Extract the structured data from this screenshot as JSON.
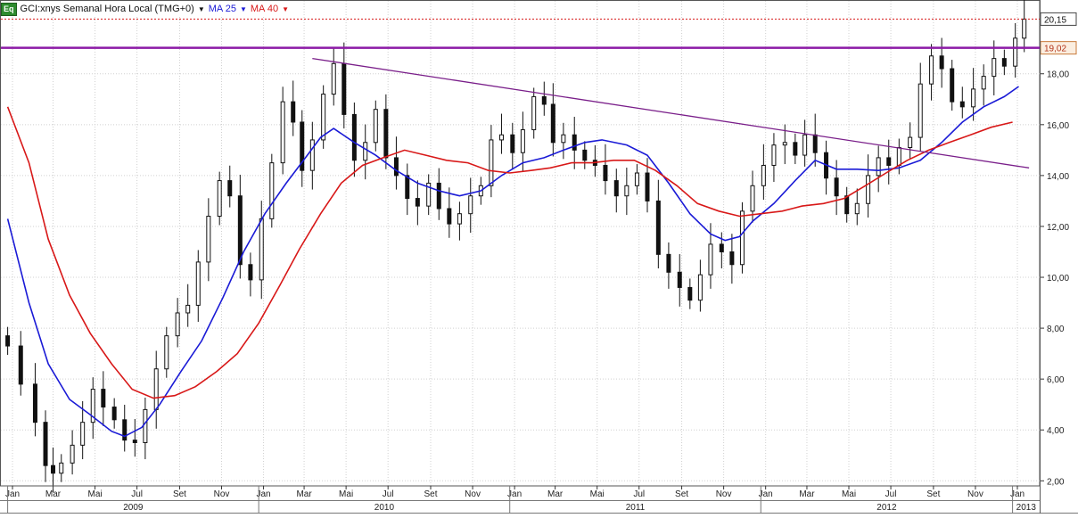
{
  "header": {
    "badge": "Eq",
    "symbol_label": "GCI:xnys Semanal Hora Local (TMG+0)",
    "ma25_label": "MA 25",
    "ma40_label": "MA 40"
  },
  "colors": {
    "ma25": "#1a1ad6",
    "ma40": "#d81818",
    "trendline": "#7a1f8a",
    "resistance": "#8c1aa6",
    "last_price": "#d81818",
    "up_candle": "#ffffff",
    "down_candle": "#111111"
  },
  "chart_data": {
    "type": "candlestick",
    "title": "GCI:xnys Semanal Hora Local (TMG+0)",
    "y_axis": {
      "side": "right",
      "ylim": [
        1.8,
        20.9
      ],
      "ticks": [
        "2,00",
        "4,00",
        "6,00",
        "8,00",
        "10,00",
        "12,00",
        "14,00",
        "16,00",
        "18,00"
      ]
    },
    "x_axis": {
      "month_labels": [
        "Jan",
        "Mar",
        "Mai",
        "Jul",
        "Set",
        "Nov",
        "Jan",
        "Mar",
        "Mai",
        "Jul",
        "Set",
        "Nov",
        "Jan",
        "Mar",
        "Mai",
        "Jul",
        "Set",
        "Nov",
        "Jan",
        "Mar",
        "Mai",
        "Jul",
        "Set",
        "Nov",
        "Jan"
      ],
      "year_labels": [
        "2009",
        "2010",
        "2011",
        "2012",
        "2013"
      ]
    },
    "price_labels": {
      "last": "20,15",
      "level": "19,02"
    },
    "horizontal_lines": [
      {
        "name": "last-price",
        "value": 20.15,
        "style": "dotted"
      },
      {
        "name": "resistance",
        "value": 19.02,
        "style": "solid"
      }
    ],
    "trendline": {
      "start": {
        "date": "2010-03-20",
        "value": 18.6
      },
      "end": {
        "date": "2013-01-25",
        "value": 14.3
      }
    },
    "series": [
      {
        "name": "MA 25",
        "points": [
          [
            "2009-01-01",
            12.3
          ],
          [
            "2009-02-01",
            9.0
          ],
          [
            "2009-03-01",
            6.6
          ],
          [
            "2009-04-01",
            5.2
          ],
          [
            "2009-05-01",
            4.6
          ],
          [
            "2009-06-01",
            3.95
          ],
          [
            "2009-06-20",
            3.75
          ],
          [
            "2009-07-15",
            4.1
          ],
          [
            "2009-08-10",
            5.0
          ],
          [
            "2009-09-10",
            6.3
          ],
          [
            "2009-10-10",
            7.5
          ],
          [
            "2009-11-10",
            9.2
          ],
          [
            "2009-12-10",
            11.0
          ],
          [
            "2010-01-10",
            12.5
          ],
          [
            "2010-02-10",
            13.7
          ],
          [
            "2010-03-10",
            14.7
          ],
          [
            "2010-04-01",
            15.5
          ],
          [
            "2010-04-20",
            15.85
          ],
          [
            "2010-05-20",
            15.3
          ],
          [
            "2010-06-20",
            14.8
          ],
          [
            "2010-07-20",
            14.2
          ],
          [
            "2010-08-20",
            13.7
          ],
          [
            "2010-09-20",
            13.4
          ],
          [
            "2010-10-20",
            13.2
          ],
          [
            "2010-11-20",
            13.4
          ],
          [
            "2010-12-20",
            14.0
          ],
          [
            "2011-01-20",
            14.5
          ],
          [
            "2011-02-20",
            14.7
          ],
          [
            "2011-03-20",
            15.0
          ],
          [
            "2011-04-20",
            15.3
          ],
          [
            "2011-05-15",
            15.4
          ],
          [
            "2011-06-20",
            15.2
          ],
          [
            "2011-07-20",
            14.8
          ],
          [
            "2011-08-20",
            13.7
          ],
          [
            "2011-09-20",
            12.5
          ],
          [
            "2011-10-20",
            11.7
          ],
          [
            "2011-11-10",
            11.45
          ],
          [
            "2011-12-01",
            11.6
          ],
          [
            "2011-12-20",
            12.2
          ],
          [
            "2012-01-20",
            12.9
          ],
          [
            "2012-02-20",
            13.8
          ],
          [
            "2012-03-20",
            14.6
          ],
          [
            "2012-04-20",
            14.25
          ],
          [
            "2012-05-20",
            14.25
          ],
          [
            "2012-06-20",
            14.2
          ],
          [
            "2012-07-20",
            14.3
          ],
          [
            "2012-08-20",
            14.6
          ],
          [
            "2012-09-20",
            15.3
          ],
          [
            "2012-10-20",
            16.1
          ],
          [
            "2012-11-20",
            16.7
          ],
          [
            "2012-12-20",
            17.1
          ],
          [
            "2013-01-10",
            17.5
          ]
        ]
      },
      {
        "name": "MA 40",
        "points": [
          [
            "2009-01-01",
            16.7
          ],
          [
            "2009-02-01",
            14.5
          ],
          [
            "2009-03-01",
            11.5
          ],
          [
            "2009-04-01",
            9.3
          ],
          [
            "2009-05-01",
            7.8
          ],
          [
            "2009-06-01",
            6.6
          ],
          [
            "2009-07-01",
            5.6
          ],
          [
            "2009-08-01",
            5.25
          ],
          [
            "2009-09-01",
            5.35
          ],
          [
            "2009-10-01",
            5.7
          ],
          [
            "2009-11-01",
            6.3
          ],
          [
            "2009-12-01",
            7.0
          ],
          [
            "2010-01-01",
            8.2
          ],
          [
            "2010-02-01",
            9.7
          ],
          [
            "2010-03-01",
            11.1
          ],
          [
            "2010-04-01",
            12.5
          ],
          [
            "2010-05-01",
            13.7
          ],
          [
            "2010-06-01",
            14.4
          ],
          [
            "2010-07-01",
            14.7
          ],
          [
            "2010-08-01",
            15.0
          ],
          [
            "2010-09-01",
            14.8
          ],
          [
            "2010-10-01",
            14.6
          ],
          [
            "2010-11-01",
            14.5
          ],
          [
            "2010-12-01",
            14.2
          ],
          [
            "2011-01-01",
            14.1
          ],
          [
            "2011-02-01",
            14.2
          ],
          [
            "2011-03-01",
            14.3
          ],
          [
            "2011-04-01",
            14.5
          ],
          [
            "2011-05-01",
            14.5
          ],
          [
            "2011-06-01",
            14.6
          ],
          [
            "2011-07-01",
            14.6
          ],
          [
            "2011-08-01",
            14.2
          ],
          [
            "2011-09-01",
            13.6
          ],
          [
            "2011-10-01",
            12.9
          ],
          [
            "2011-11-01",
            12.6
          ],
          [
            "2011-12-01",
            12.4
          ],
          [
            "2012-01-01",
            12.5
          ],
          [
            "2012-02-01",
            12.6
          ],
          [
            "2012-03-01",
            12.8
          ],
          [
            "2012-04-01",
            12.9
          ],
          [
            "2012-05-01",
            13.1
          ],
          [
            "2012-06-01",
            13.6
          ],
          [
            "2012-07-01",
            14.1
          ],
          [
            "2012-08-01",
            14.6
          ],
          [
            "2012-09-01",
            15.0
          ],
          [
            "2012-10-01",
            15.3
          ],
          [
            "2012-11-01",
            15.6
          ],
          [
            "2012-12-01",
            15.9
          ],
          [
            "2013-01-01",
            16.1
          ]
        ]
      }
    ],
    "candles_close": [
      [
        "2009-01-01",
        7.3
      ],
      [
        "2009-01-20",
        5.8
      ],
      [
        "2009-02-10",
        4.3
      ],
      [
        "2009-02-25",
        2.6
      ],
      [
        "2009-03-08",
        2.3
      ],
      [
        "2009-03-20",
        2.7
      ],
      [
        "2009-04-05",
        3.4
      ],
      [
        "2009-04-20",
        4.3
      ],
      [
        "2009-05-05",
        5.6
      ],
      [
        "2009-05-20",
        4.9
      ],
      [
        "2009-06-05",
        4.4
      ],
      [
        "2009-06-20",
        3.6
      ],
      [
        "2009-07-05",
        3.5
      ],
      [
        "2009-07-20",
        4.8
      ],
      [
        "2009-08-05",
        6.4
      ],
      [
        "2009-08-20",
        7.7
      ],
      [
        "2009-09-05",
        8.6
      ],
      [
        "2009-09-20",
        8.9
      ],
      [
        "2009-10-05",
        10.6
      ],
      [
        "2009-10-20",
        12.4
      ],
      [
        "2009-11-05",
        13.8
      ],
      [
        "2009-11-20",
        13.2
      ],
      [
        "2009-12-05",
        10.5
      ],
      [
        "2009-12-20",
        9.9
      ],
      [
        "2010-01-05",
        12.3
      ],
      [
        "2010-01-20",
        14.5
      ],
      [
        "2010-02-05",
        16.9
      ],
      [
        "2010-02-20",
        16.1
      ],
      [
        "2010-03-05",
        14.2
      ],
      [
        "2010-03-20",
        15.4
      ],
      [
        "2010-04-05",
        17.2
      ],
      [
        "2010-04-20",
        18.4
      ],
      [
        "2010-05-05",
        16.4
      ],
      [
        "2010-05-20",
        14.6
      ],
      [
        "2010-06-05",
        15.3
      ],
      [
        "2010-06-20",
        16.6
      ],
      [
        "2010-07-05",
        14.7
      ],
      [
        "2010-07-20",
        14.0
      ],
      [
        "2010-08-05",
        13.1
      ],
      [
        "2010-08-20",
        12.8
      ],
      [
        "2010-09-05",
        13.7
      ],
      [
        "2010-09-20",
        12.7
      ],
      [
        "2010-10-05",
        12.1
      ],
      [
        "2010-10-20",
        12.5
      ],
      [
        "2010-11-05",
        13.2
      ],
      [
        "2010-11-20",
        13.6
      ],
      [
        "2010-12-05",
        15.4
      ],
      [
        "2010-12-20",
        15.6
      ],
      [
        "2011-01-05",
        14.9
      ],
      [
        "2011-01-20",
        15.8
      ],
      [
        "2011-02-05",
        17.1
      ],
      [
        "2011-02-20",
        16.8
      ],
      [
        "2011-03-05",
        15.3
      ],
      [
        "2011-03-20",
        15.6
      ],
      [
        "2011-04-05",
        15.0
      ],
      [
        "2011-04-20",
        14.6
      ],
      [
        "2011-05-05",
        14.4
      ],
      [
        "2011-05-20",
        13.8
      ],
      [
        "2011-06-05",
        13.2
      ],
      [
        "2011-06-20",
        13.6
      ],
      [
        "2011-07-05",
        14.1
      ],
      [
        "2011-07-20",
        13.0
      ],
      [
        "2011-08-05",
        10.9
      ],
      [
        "2011-08-20",
        10.2
      ],
      [
        "2011-09-05",
        9.6
      ],
      [
        "2011-09-20",
        9.1
      ],
      [
        "2011-10-05",
        10.1
      ],
      [
        "2011-10-20",
        11.3
      ],
      [
        "2011-11-05",
        11.0
      ],
      [
        "2011-11-20",
        10.5
      ],
      [
        "2011-12-05",
        12.6
      ],
      [
        "2011-12-20",
        13.6
      ],
      [
        "2012-01-05",
        14.4
      ],
      [
        "2012-01-20",
        15.2
      ],
      [
        "2012-02-05",
        15.3
      ],
      [
        "2012-02-20",
        14.8
      ],
      [
        "2012-03-05",
        15.6
      ],
      [
        "2012-03-20",
        14.9
      ],
      [
        "2012-04-05",
        13.9
      ],
      [
        "2012-04-20",
        13.2
      ],
      [
        "2012-05-05",
        12.5
      ],
      [
        "2012-05-20",
        12.9
      ],
      [
        "2012-06-05",
        14.0
      ],
      [
        "2012-06-20",
        14.7
      ],
      [
        "2012-07-05",
        14.4
      ],
      [
        "2012-07-20",
        15.1
      ],
      [
        "2012-08-05",
        15.5
      ],
      [
        "2012-08-20",
        17.6
      ],
      [
        "2012-09-05",
        18.7
      ],
      [
        "2012-09-20",
        18.2
      ],
      [
        "2012-10-05",
        16.9
      ],
      [
        "2012-10-20",
        16.7
      ],
      [
        "2012-11-05",
        17.4
      ],
      [
        "2012-11-20",
        17.9
      ],
      [
        "2012-12-05",
        18.6
      ],
      [
        "2012-12-20",
        18.3
      ],
      [
        "2013-01-05",
        19.4
      ],
      [
        "2013-01-18",
        20.15
      ]
    ]
  }
}
